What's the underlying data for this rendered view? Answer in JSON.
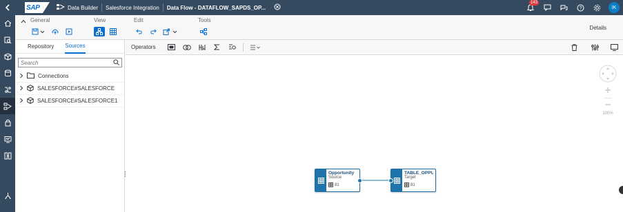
{
  "shell": {
    "logo_text": "SAP",
    "breadcrumb": [
      "Data Builder",
      "Salesforce Integration",
      "Data Flow - DATAFLOW_SAPDS_OP..."
    ],
    "notification_count": "143",
    "avatar_initials": "IK"
  },
  "toolbar": {
    "groups": {
      "general": "General",
      "view": "View",
      "edit": "Edit",
      "tools": "Tools"
    },
    "details_label": "Details"
  },
  "leftpanel": {
    "tabs": [
      "Repository",
      "Sources"
    ],
    "active_tab": "Sources",
    "search_placeholder": "Search",
    "tree": [
      {
        "label": "Connections",
        "icon": "folder-icon"
      },
      {
        "label": "SALESFORCE#SALESFORCE",
        "icon": "cube-icon"
      },
      {
        "label": "SALESFORCE#SALESFORCE1",
        "icon": "cube-icon"
      }
    ]
  },
  "canvasbar": {
    "operators_label": "Operators"
  },
  "canvas": {
    "zoom_level": "100%",
    "nodes": [
      {
        "name": "Opportunity",
        "role": "Source",
        "count": "81"
      },
      {
        "name": "TABLE_OPPU...",
        "role": "Target",
        "count": "81"
      }
    ]
  },
  "colors": {
    "shell_bg": "#354a5f",
    "accent": "#0a6ed1",
    "node_header": "#1e74ab",
    "badge": "#e03a3e"
  }
}
